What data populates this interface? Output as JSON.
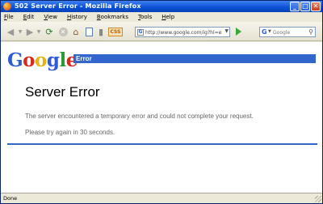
{
  "window": {
    "title": "502 Server Error - Mozilla Firefox",
    "controls": {
      "minimize": "_",
      "maximize": "□",
      "close": "✕"
    }
  },
  "menu": {
    "items": [
      "File",
      "Edit",
      "View",
      "History",
      "Bookmarks",
      "Tools",
      "Help"
    ]
  },
  "toolbar": {
    "css_label": "CSS",
    "url": "http://www.google.com/ig?hl=en",
    "search_placeholder": "Google",
    "search_engine_glyph": "G",
    "icons": [
      "back-icon",
      "forward-icon",
      "reload-icon",
      "stop-icon",
      "home-icon",
      "bookmark-icon",
      "bookmarks-sidebar-icon",
      "css-icon",
      "go-icon",
      "search-icon"
    ]
  },
  "page": {
    "logo": [
      "G",
      "o",
      "o",
      "g",
      "l",
      "e"
    ],
    "logo_colors": [
      "#2f5bd3",
      "#d72a1f",
      "#e7b413",
      "#2f5bd3",
      "#2c9a32",
      "#d72a1f"
    ],
    "bar_label": "Error",
    "heading": "Server Error",
    "message": "The server encountered a temporary error and could not complete your request.",
    "retry": "Please try again in 30 seconds."
  },
  "status": {
    "text": "Done"
  },
  "colors": {
    "accent": "#3366cc",
    "titlebar": "#0a4fd4"
  }
}
